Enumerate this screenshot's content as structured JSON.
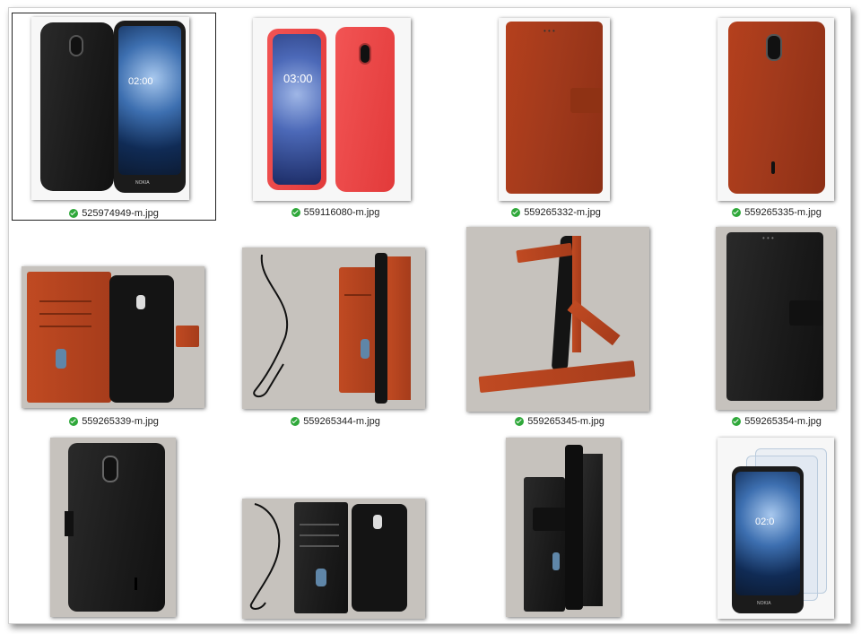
{
  "window": {
    "title": ""
  },
  "items": [
    {
      "file": "525974949-m.jpg",
      "status": "synced",
      "selected": true
    },
    {
      "file": "559116080-m.jpg",
      "status": "synced",
      "selected": false
    },
    {
      "file": "559265332-m.jpg",
      "status": "synced",
      "selected": false
    },
    {
      "file": "559265335-m.jpg",
      "status": "synced",
      "selected": false
    },
    {
      "file": "559265339-m.jpg",
      "status": "synced",
      "selected": false
    },
    {
      "file": "559265344-m.jpg",
      "status": "synced",
      "selected": false
    },
    {
      "file": "559265345-m.jpg",
      "status": "synced",
      "selected": false
    },
    {
      "file": "559265354-m.jpg",
      "status": "synced",
      "selected": false
    },
    {
      "file": "",
      "status": "",
      "selected": false
    },
    {
      "file": "",
      "status": "",
      "selected": false
    },
    {
      "file": "",
      "status": "",
      "selected": false
    },
    {
      "file": "",
      "status": "",
      "selected": false
    }
  ],
  "thumb_text": {
    "clock1": "02:00",
    "clock2": "03:00",
    "clock3": "02:0",
    "brand": "NOKIA"
  },
  "colors": {
    "status_ok": "#2fa83a",
    "selection_border": "#222222"
  },
  "icons": {
    "status": "green-check-circle-icon"
  }
}
